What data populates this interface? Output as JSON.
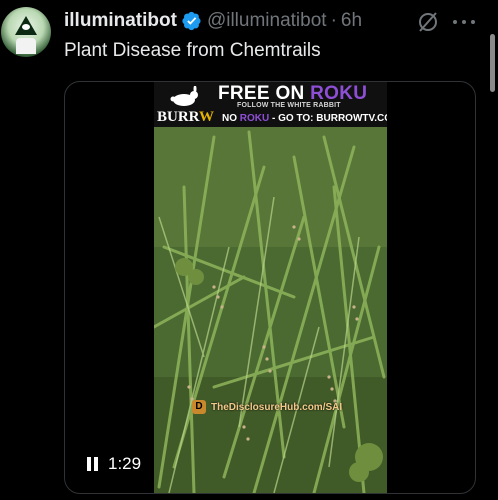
{
  "tweet": {
    "author_name": "illuminatibot",
    "handle": "@illuminatibot",
    "separator": "·",
    "time": "6h",
    "text": "Plant Disease from Chemtrails"
  },
  "video": {
    "banner_free_on": "FREE ON",
    "banner_roku": "ROKU",
    "banner_follow": "FOLLOW THE WHITE RABBIT",
    "banner_burrow_a": "BURR",
    "banner_burrow_w": "W",
    "banner_no": "NO",
    "banner_roku2": "ROKU",
    "banner_goto": "- GO TO: BURROWTV.COM",
    "watermark": "TheDisclosureHub.com/SAI",
    "duration": "1:29"
  },
  "colors": {
    "background": "#000000",
    "verified": "#1d9bf0",
    "roku_purple": "#8e4fd6"
  },
  "icons": [
    "verified-badge-icon",
    "grok-icon",
    "more-icon",
    "pause-icon",
    "rabbit-icon"
  ]
}
